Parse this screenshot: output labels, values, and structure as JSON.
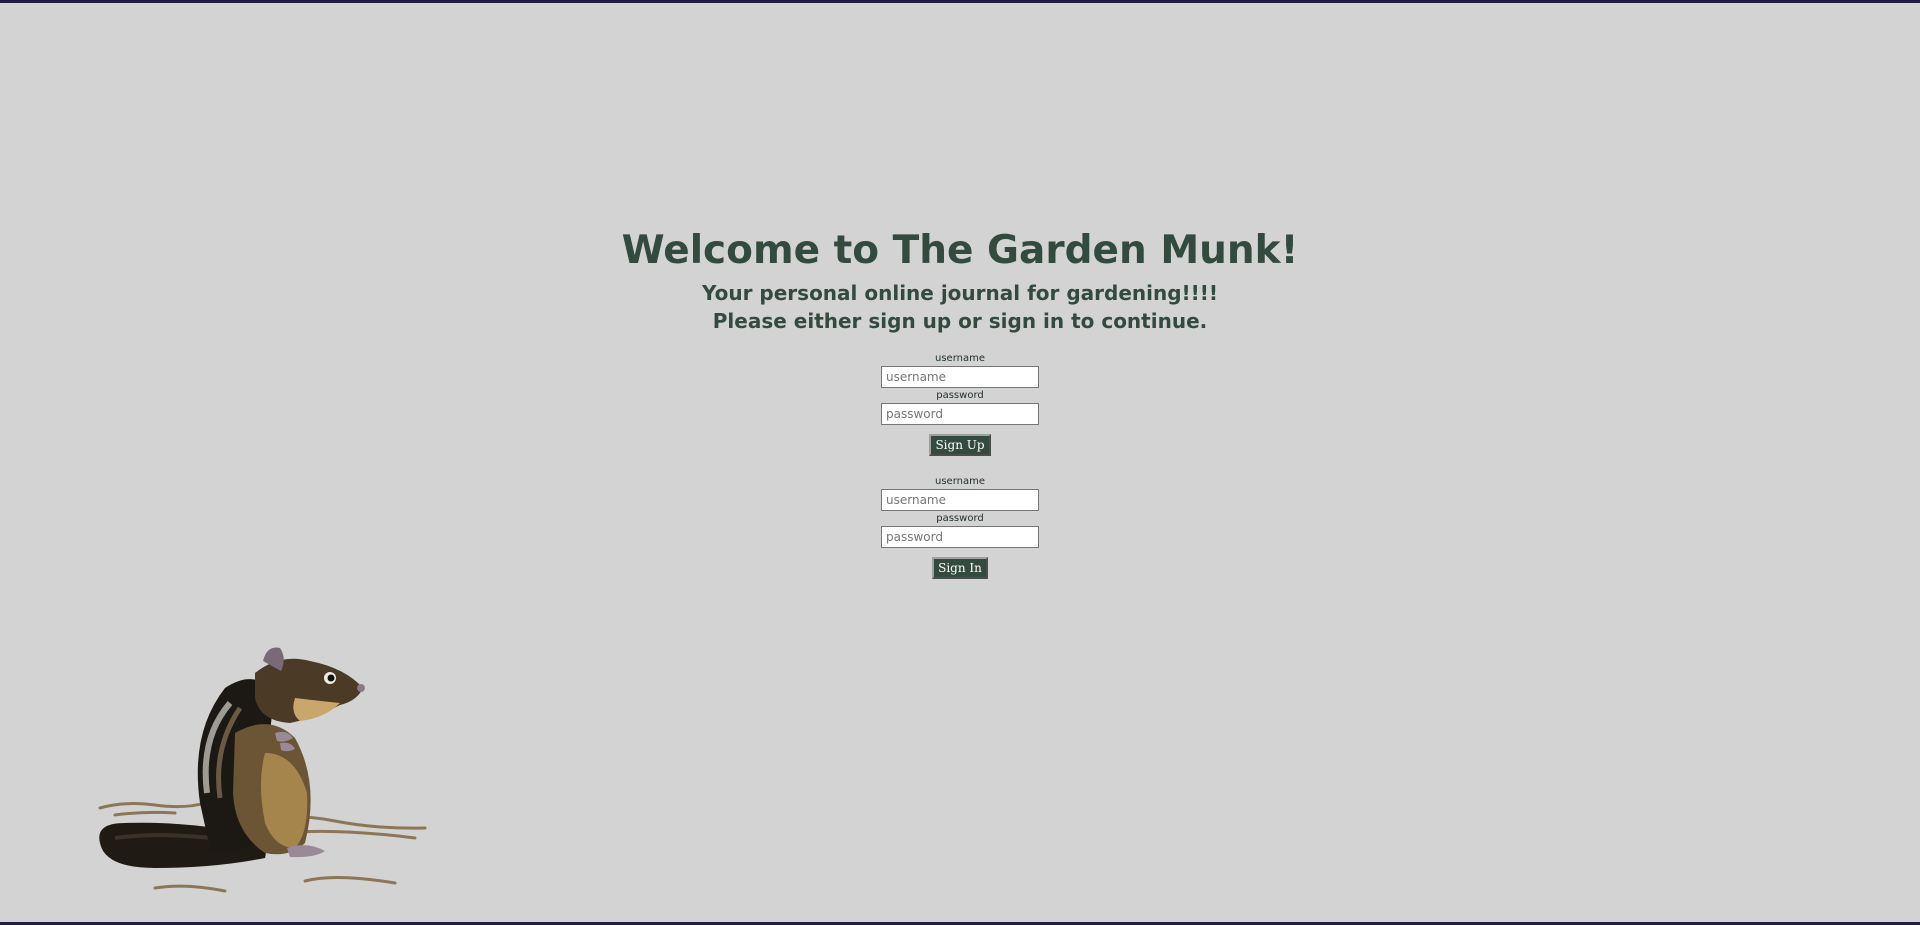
{
  "header": {
    "title": "Welcome to The Garden Munk!",
    "tagline": "Your personal online journal for gardening!!!!",
    "prompt": "Please either sign up or sign in to continue."
  },
  "signup": {
    "username_label": "username",
    "username_placeholder": "username",
    "password_label": "password",
    "password_placeholder": "password",
    "button_label": "Sign Up"
  },
  "signin": {
    "username_label": "username",
    "username_placeholder": "username",
    "password_label": "password",
    "password_placeholder": "password",
    "button_label": "Sign In"
  },
  "colors": {
    "background": "#d3d3d3",
    "accent": "#334a3f",
    "frame": "#221d44"
  },
  "illustration": {
    "name": "chipmunk-illustration"
  }
}
